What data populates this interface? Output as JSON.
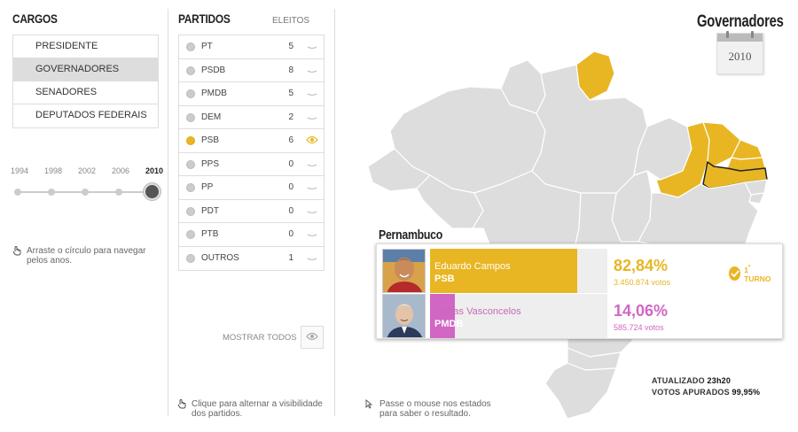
{
  "cargos": {
    "title": "CARGOS",
    "items": [
      {
        "label": "PRESIDENTE",
        "active": false
      },
      {
        "label": "GOVERNADORES",
        "active": true
      },
      {
        "label": "SENADORES",
        "active": false
      },
      {
        "label": "DEPUTADOS FEDERAIS",
        "active": false
      }
    ]
  },
  "timeline": {
    "years": [
      "1994",
      "1998",
      "2002",
      "2006",
      "2010"
    ],
    "selected": "2010",
    "hint": "Arraste o círculo para navegar pelos anos."
  },
  "partidos": {
    "title": "PARTIDOS",
    "eleitos_label": "ELEITOS",
    "items": [
      {
        "name": "PT",
        "count": "5"
      },
      {
        "name": "PSDB",
        "count": "8"
      },
      {
        "name": "PMDB",
        "count": "5"
      },
      {
        "name": "DEM",
        "count": "2"
      },
      {
        "name": "PSB",
        "count": "6"
      },
      {
        "name": "PPS",
        "count": "0"
      },
      {
        "name": "PP",
        "count": "0"
      },
      {
        "name": "PDT",
        "count": "0"
      },
      {
        "name": "PTB",
        "count": "0"
      },
      {
        "name": "OUTROS",
        "count": "1"
      }
    ],
    "active_party": "PSB",
    "show_all_label": "MOSTRAR TODOS",
    "hint": "Clique para alternar a visibilidade dos partidos."
  },
  "map_hint": "Passe o mouse nos estados para saber o resultado.",
  "header": {
    "title": "Governadores",
    "calendar_year": "2010"
  },
  "result": {
    "state": "Pernambuco",
    "turno_num": "1",
    "turno_sup": "º",
    "turno_label": "TURNO",
    "candidates": [
      {
        "name": "Eduardo Campos",
        "party": "PSB",
        "percent": "82,84%",
        "votes": "3.450.874 votos",
        "share": 0.8284,
        "color": "#e8b623"
      },
      {
        "name": "Jarbas Vasconcelos",
        "party": "PMDB",
        "percent": "14,06%",
        "votes": "585.724 votos",
        "share": 0.1406,
        "color": "#d166c4"
      }
    ]
  },
  "status": {
    "updated_label": "ATUALIZADO",
    "updated_value": "23h20",
    "counted_label": "VOTOS APURADOS",
    "counted_value": "99,95%"
  },
  "colors": {
    "psb": "#e8b623",
    "pmdb": "#d166c4",
    "state_default": "#dddddd",
    "state_border": "#ffffff"
  },
  "icons": {
    "eye": "eye-icon",
    "hand": "hand-pointer-icon",
    "cursor": "arrow-cursor-icon",
    "check": "check-circle-icon",
    "calendar": "calendar-icon"
  }
}
